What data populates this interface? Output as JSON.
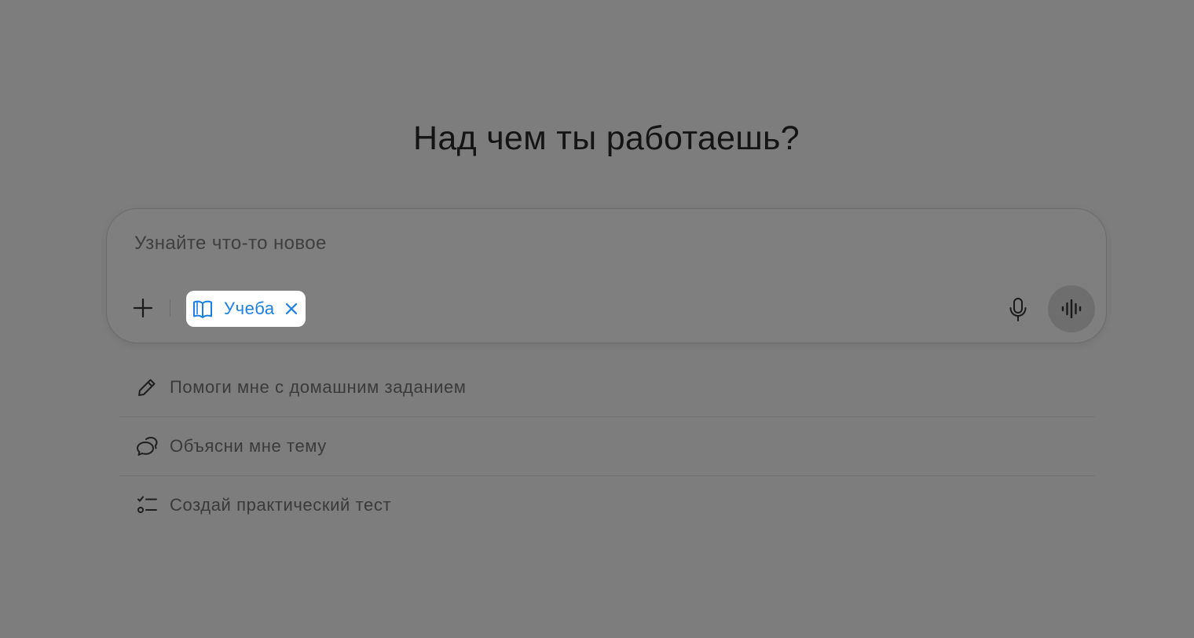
{
  "heading": "Над чем ты работаешь?",
  "composer": {
    "placeholder": "Узнайте что-то новое",
    "value": ""
  },
  "tool_chip": {
    "label": "Учеба",
    "icon": "book-open-icon",
    "color": "#1b7fe8"
  },
  "suggestions": [
    {
      "icon": "pencil-icon",
      "label": "Помоги мне с домашним заданием"
    },
    {
      "icon": "chat-bubbles-icon",
      "label": "Объясни мне тему"
    },
    {
      "icon": "checklist-icon",
      "label": "Создай практический тест"
    }
  ],
  "colors": {
    "overlay_background": "#7d7d7d",
    "chip_background": "#ffffff",
    "accent": "#1b7fe8"
  }
}
